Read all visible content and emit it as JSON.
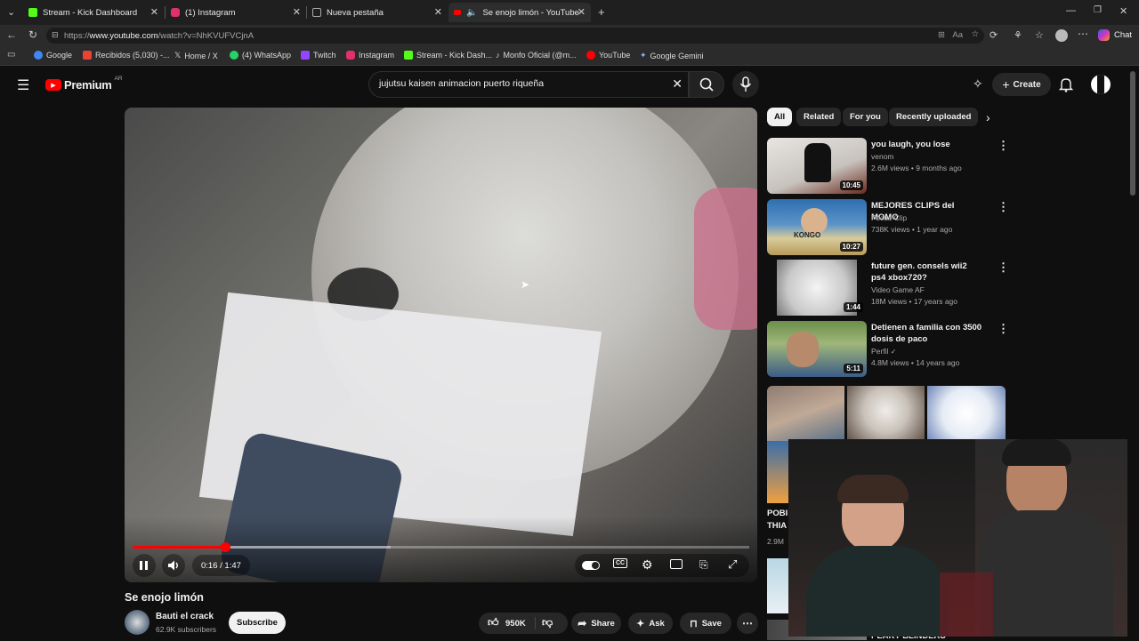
{
  "browser": {
    "tabs": [
      {
        "title": "Stream - Kick Dashboard",
        "color": "#53fc18"
      },
      {
        "title": "(1) Instagram",
        "color": "#e1306c"
      },
      {
        "title": "Nueva pestaña",
        "color": "#aaaaaa"
      },
      {
        "title": "Se enojo limón - YouTube",
        "color": "#ff0000"
      }
    ],
    "url_prefix": "https://",
    "url_host": "www.youtube.com",
    "url_path": "/watch?v=NhKVUFVCjnA",
    "chat_label": "Chat",
    "bookmarks": [
      {
        "label": "Google",
        "color": "#4285f4"
      },
      {
        "label": "Recibidos (5,030) -...",
        "color": "#ea4335"
      },
      {
        "label": "Home / X",
        "color": "#e7e7e7"
      },
      {
        "label": "(4) WhatsApp",
        "color": "#25d366"
      },
      {
        "label": "Twitch",
        "color": "#9146ff"
      },
      {
        "label": "Instagram",
        "color": "#e1306c"
      },
      {
        "label": "Stream - Kick Dash...",
        "color": "#53fc18"
      },
      {
        "label": "Monfo Oficial (@m...",
        "color": "#e7e7e7"
      },
      {
        "label": "YouTube",
        "color": "#ff0000"
      },
      {
        "label": "Google Gemini",
        "color": "#8ab4f8"
      }
    ]
  },
  "youtube": {
    "logo_text": "Premium",
    "logo_region": "AR",
    "search_query": "jujutsu kaisen animacion  puerto riqueña",
    "create_label": "Create",
    "player": {
      "time": "0:16 / 1:47",
      "progress_fraction": 0.15
    },
    "video_title": "Se enojo limón",
    "channel_name": "Bauti el crack",
    "channel_subs": "62.9K subscribers",
    "subscribe_label": "Subscribe",
    "likes": "950K",
    "share_label": "Share",
    "ask_label": "Ask",
    "save_label": "Save",
    "chips": [
      "All",
      "Related",
      "For you",
      "Recently uploaded"
    ],
    "related": [
      {
        "title": "you laugh, you lose",
        "channel": "venom",
        "meta": "2.6M views • 9 months ago",
        "duration": "10:45"
      },
      {
        "title": "MEJORES CLIPS del MOMO",
        "channel": "Focus Clip",
        "meta": "738K views • 1 year ago",
        "duration": "10:27"
      },
      {
        "title": "future gen. consels wii2 ps4 xbox720?",
        "channel": "Video Game AF",
        "meta": "18M views • 17 years ago",
        "duration": "1:44"
      },
      {
        "title": "Detienen a familia con 3500 dosis de paco",
        "channel": "Perfil",
        "meta": "4.8M views • 14 years ago",
        "duration": "5:11"
      }
    ],
    "partial_title_1": "POBI",
    "partial_title_2": "THIA",
    "partial_meta": "2.9M",
    "partial_bottom": "PEAKY BLINDERS"
  }
}
